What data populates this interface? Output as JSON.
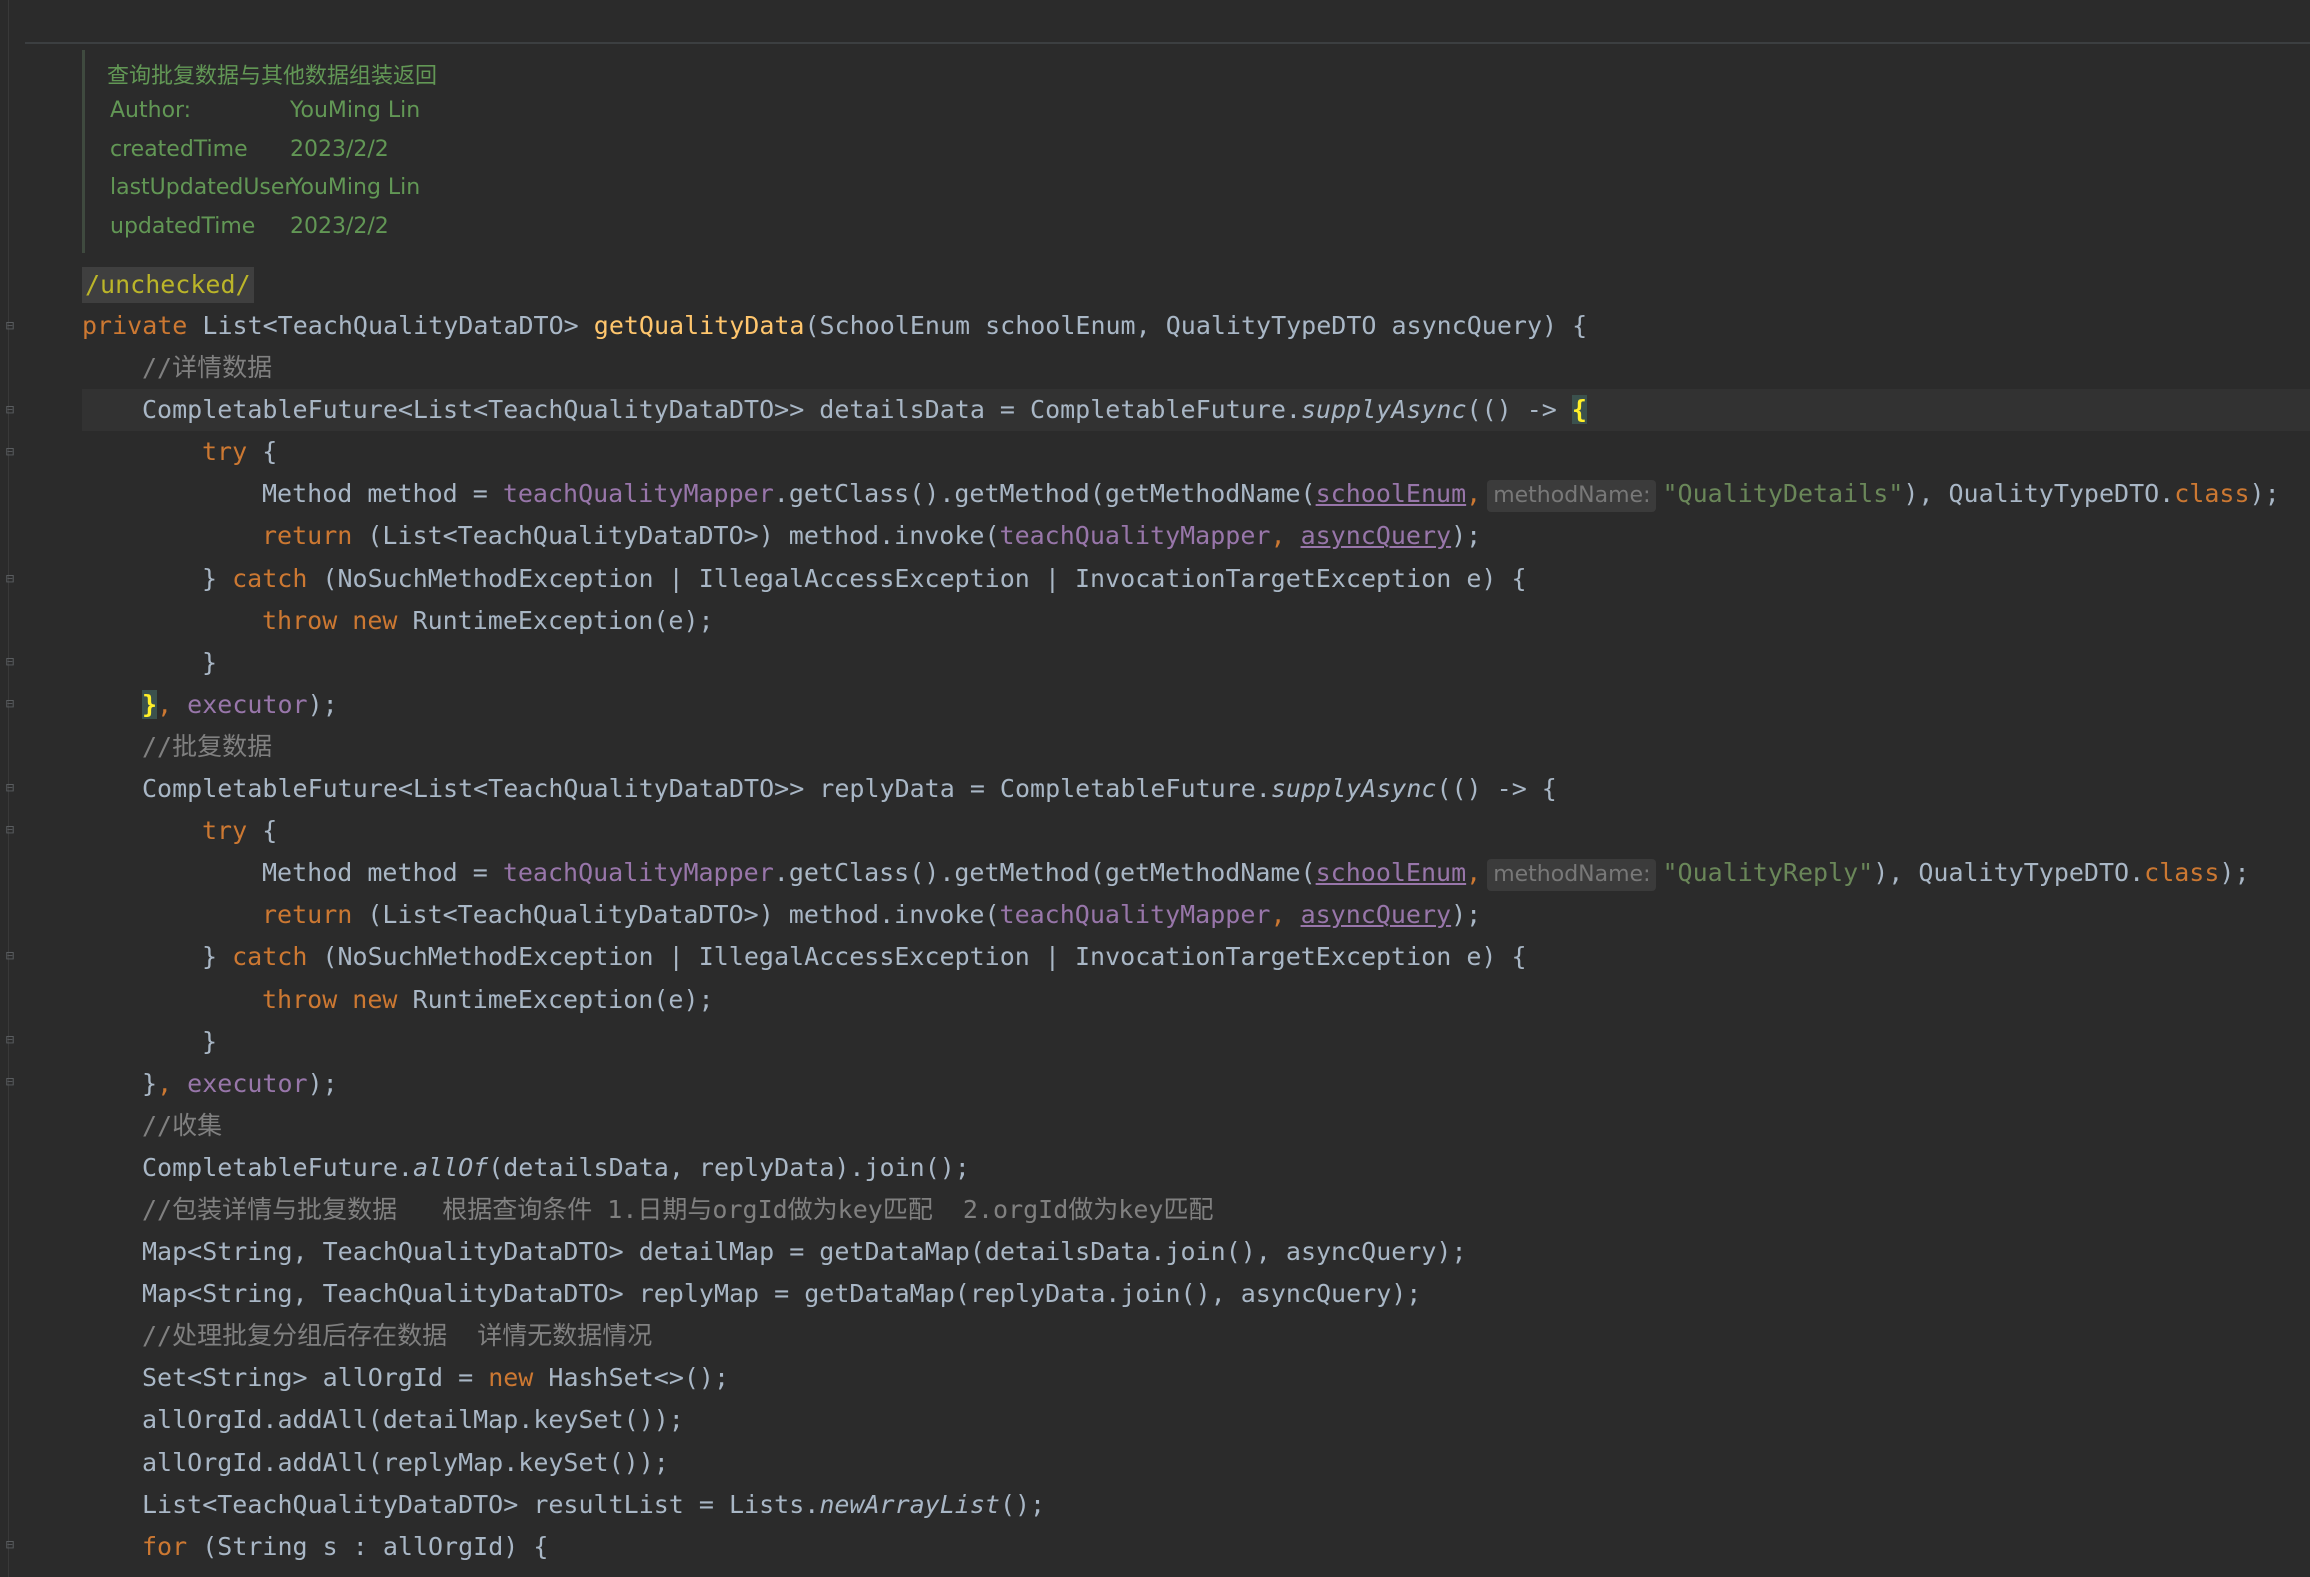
{
  "doc": {
    "title": "查询批复数据与其他数据组装返回",
    "rows": [
      {
        "key": "Author:",
        "value": "YouMing Lin"
      },
      {
        "key": "createdTime",
        "value": "2023/2/2"
      },
      {
        "key": "lastUpdatedUser",
        "value": "YouMing Lin"
      },
      {
        "key": "updatedTime",
        "value": "2023/2/2"
      }
    ]
  },
  "annotation": "/unchecked/",
  "code": {
    "l1": {
      "a": "private ",
      "b": "List<TeachQualityDataDTO> ",
      "c": "getQualityData",
      "d": "(SchoolEnum schoolEnum, QualityTypeDTO asyncQuery) {"
    },
    "l2": "//详情数据",
    "l3": {
      "a": "CompletableFuture<List<TeachQualityDataDTO>> detailsData = CompletableFuture.",
      "b": "supplyAsync",
      "c": "(() -> ",
      "d": "{"
    },
    "l4": {
      "a": "try",
      "b": " {"
    },
    "l5": {
      "a": "Method method = ",
      "b": "teachQualityMapper",
      "c": ".getClass().getMethod(getMethodName(",
      "d": "schoolEnum",
      "e": ",",
      "hint": "methodName:",
      "f": "\"QualityDetails\"",
      "g": "), QualityTypeDTO.",
      "h": "class",
      "i": ");"
    },
    "l6": {
      "a": "return ",
      "b": "(List<TeachQualityDataDTO>) method.invoke(",
      "c": "teachQualityMapper",
      "d": ", ",
      "e": "asyncQuery",
      "f": ");"
    },
    "l7": {
      "a": "} ",
      "b": "catch ",
      "c": "(NoSuchMethodException | IllegalAccessException | InvocationTargetException e) {"
    },
    "l8": {
      "a": "throw new ",
      "b": "RuntimeException(e);"
    },
    "l9": "}",
    "l10": {
      "a": "}",
      "b": ", ",
      "c": "executor",
      "d": ");"
    },
    "l11": "//批复数据",
    "l12": {
      "a": "CompletableFuture<List<TeachQualityDataDTO>> replyData = CompletableFuture.",
      "b": "supplyAsync",
      "c": "(() -> {"
    },
    "l13": {
      "a": "try",
      "b": " {"
    },
    "l14": {
      "a": "Method method = ",
      "b": "teachQualityMapper",
      "c": ".getClass().getMethod(getMethodName(",
      "d": "schoolEnum",
      "e": ",",
      "hint": "methodName:",
      "f": "\"QualityReply\"",
      "g": "), QualityTypeDTO.",
      "h": "class",
      "i": ");"
    },
    "l15": {
      "a": "return ",
      "b": "(List<TeachQualityDataDTO>) method.invoke(",
      "c": "teachQualityMapper",
      "d": ", ",
      "e": "asyncQuery",
      "f": ");"
    },
    "l16": {
      "a": "} ",
      "b": "catch ",
      "c": "(NoSuchMethodException | IllegalAccessException | InvocationTargetException e) {"
    },
    "l17": {
      "a": "throw new ",
      "b": "RuntimeException(e);"
    },
    "l18": "}",
    "l19": {
      "a": "}",
      "b": ", ",
      "c": "executor",
      "d": ");"
    },
    "l20": "//收集",
    "l21": {
      "a": "CompletableFuture.",
      "b": "allOf",
      "c": "(detailsData, replyData).join();"
    },
    "l22": "//包装详情与批复数据   根据查询条件 1.日期与orgId做为key匹配  2.orgId做为key匹配",
    "l23": "Map<String, TeachQualityDataDTO> detailMap = getDataMap(detailsData.join(), asyncQuery);",
    "l24": "Map<String, TeachQualityDataDTO> replyMap = getDataMap(replyData.join(), asyncQuery);",
    "l25": "//处理批复分组后存在数据  详情无数据情况",
    "l26": {
      "a": "Set<String> allOrgId = ",
      "b": "new ",
      "c": "HashSet<>();"
    },
    "l27": "allOrgId.addAll(detailMap.keySet());",
    "l28": "allOrgId.addAll(replyMap.keySet());",
    "l29": {
      "a": "List<TeachQualityDataDTO> resultList = Lists.",
      "b": "newArrayList",
      "c": "();"
    },
    "l30": {
      "a": "for ",
      "b": "(String s : allOrgId) {"
    }
  }
}
